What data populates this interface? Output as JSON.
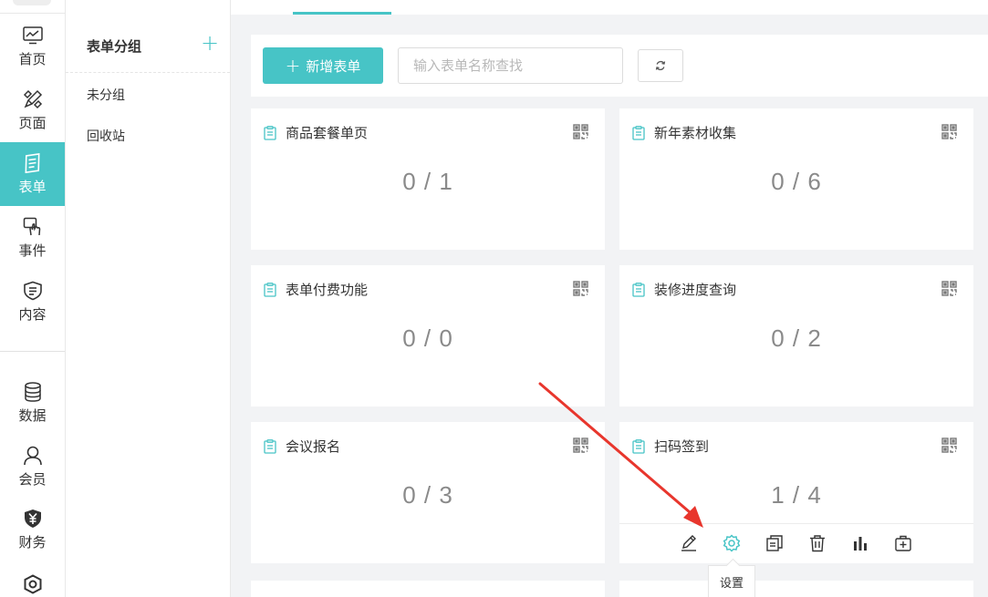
{
  "nav": {
    "items": [
      {
        "label": "首页",
        "icon": "chart-monitor-icon"
      },
      {
        "label": "页面",
        "icon": "design-tools-icon"
      },
      {
        "label": "表单",
        "icon": "form-icon",
        "active": true
      },
      {
        "label": "事件",
        "icon": "touch-icon"
      },
      {
        "label": "内容",
        "icon": "shield-list-icon"
      },
      {
        "label": "数据",
        "icon": "database-icon"
      },
      {
        "label": "会员",
        "icon": "user-icon"
      },
      {
        "label": "财务",
        "icon": "yen-shield-icon"
      }
    ],
    "partial_icon": "hex-gear-icon"
  },
  "groups": {
    "title": "表单分组",
    "add_label": "+",
    "items": [
      "未分组",
      "回收站"
    ]
  },
  "toolbar": {
    "new_label": "新增表单",
    "search_placeholder": "输入表单名称查找"
  },
  "cards": [
    {
      "title": "商品套餐单页",
      "count": "0 / 1"
    },
    {
      "title": "新年素材收集",
      "count": "0 / 6"
    },
    {
      "title": "表单付费功能",
      "count": "0 / 0"
    },
    {
      "title": "装修进度查询",
      "count": "0 / 2"
    },
    {
      "title": "会议报名",
      "count": "0 / 3"
    },
    {
      "title": "扫码签到",
      "count": "1 / 4"
    }
  ],
  "card_actions": [
    "edit-icon",
    "settings-icon",
    "copy-icon",
    "delete-icon",
    "stats-icon",
    "add-to-icon"
  ],
  "tooltip": "设置",
  "colors": {
    "accent": "#47c4c6",
    "annotation_arrow": "#e8362d",
    "background": "#f2f3f5"
  }
}
